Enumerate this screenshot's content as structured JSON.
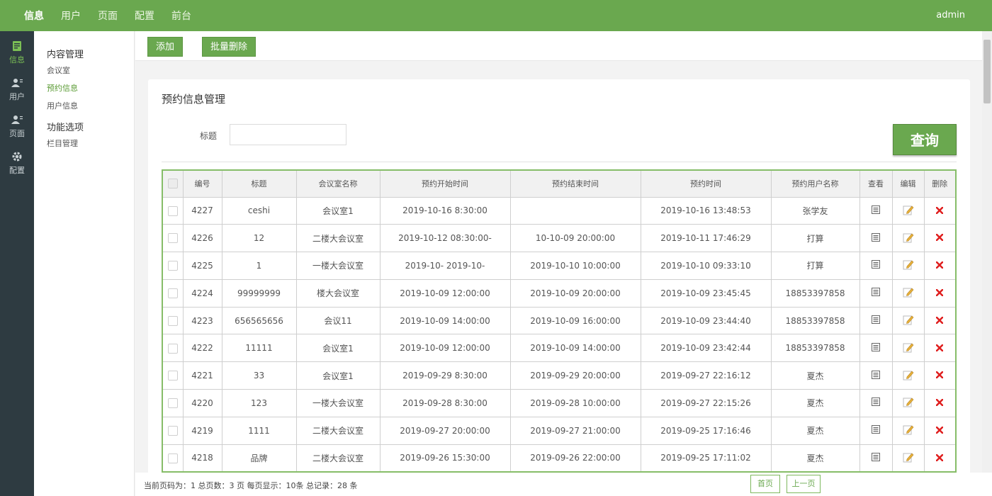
{
  "topnav": {
    "items": [
      {
        "label": "信息",
        "active": true
      },
      {
        "label": "用户",
        "active": false
      },
      {
        "label": "页面",
        "active": false
      },
      {
        "label": "配置",
        "active": false
      },
      {
        "label": "前台",
        "active": false
      }
    ],
    "user": "admin"
  },
  "rail": {
    "items": [
      {
        "label": "信息",
        "icon": "document-icon"
      },
      {
        "label": "用户",
        "icon": "user-icon"
      },
      {
        "label": "页面",
        "icon": "user-icon"
      },
      {
        "label": "配置",
        "icon": "gear-icon"
      }
    ]
  },
  "submenu": {
    "group1": "内容管理",
    "links1": [
      "会议室",
      "预约信息",
      "用户信息"
    ],
    "group2": "功能选项",
    "links2": [
      "栏目管理"
    ]
  },
  "toolbar": {
    "add_label": "添加",
    "batch_delete_label": "批量删除"
  },
  "card": {
    "title": "预约信息管理",
    "search_label": "标题",
    "search_value": "",
    "query_label": "查询"
  },
  "table": {
    "headers": [
      "编号",
      "标题",
      "会议室名称",
      "预约开始时间",
      "预约结束时间",
      "预约时间",
      "预约用户名称",
      "查看",
      "编辑",
      "删除"
    ],
    "rows": [
      [
        "4227",
        "ceshi",
        "会议室1",
        "2019-10-16 8:30:00",
        "",
        "2019-10-16 13:48:53",
        "张学友"
      ],
      [
        "4226",
        "12",
        "二楼大会议室",
        "2019-10-12 08:30:00-",
        "10-10-09 20:00:00",
        "2019-10-11 17:46:29",
        "打算"
      ],
      [
        "4225",
        "1",
        "一楼大会议室",
        "2019-10-    2019-10-",
        "2019-10-10 10:00:00",
        "2019-10-10 09:33:10",
        "打算"
      ],
      [
        "4224",
        "99999999",
        "楼大会议室",
        "2019-10-09 12:00:00",
        "2019-10-09 20:00:00",
        "2019-10-09 23:45:45",
        "18853397858"
      ],
      [
        "4223",
        "656565656",
        "会议11",
        "2019-10-09 14:00:00",
        "2019-10-09 16:00:00",
        "2019-10-09 23:44:40",
        "18853397858"
      ],
      [
        "4222",
        "11111",
        "会议室1",
        "2019-10-09 12:00:00",
        "2019-10-09 14:00:00",
        "2019-10-09 23:42:44",
        "18853397858"
      ],
      [
        "4221",
        "33",
        "会议室1",
        "2019-09-29 8:30:00",
        "2019-09-29 20:00:00",
        "2019-09-27 22:16:12",
        "夏杰"
      ],
      [
        "4220",
        "123",
        "一楼大会议室",
        "2019-09-28 8:30:00",
        "2019-09-28 10:00:00",
        "2019-09-27 22:15:26",
        "夏杰"
      ],
      [
        "4219",
        "1111",
        "二楼大会议室",
        "2019-09-27 20:00:00",
        "2019-09-27 21:00:00",
        "2019-09-25 17:16:46",
        "夏杰"
      ],
      [
        "4218",
        "品牌",
        "二楼大会议室",
        "2019-09-26 15:30:00",
        "2019-09-26 22:00:00",
        "2019-09-25 17:11:02",
        "夏杰"
      ]
    ]
  },
  "footer": {
    "info": "当前页码为：1 总页数：3 页 每页显示：10条 总记录：28 条",
    "first": "首页",
    "prev": "上一页"
  },
  "colors": {
    "accent": "#6aa84f",
    "delete": "#e02020",
    "rail": "#2e3b41"
  }
}
